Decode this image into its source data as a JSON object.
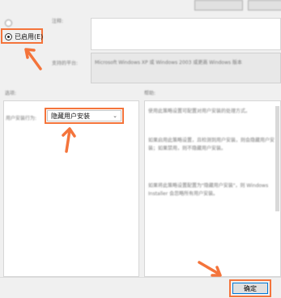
{
  "window": {
    "title": "",
    "top_button_label": ""
  },
  "radios": {
    "not_configured_label": "",
    "enabled_label": "已启用(E)",
    "disabled_label": ""
  },
  "labels": {
    "comment": "注释:",
    "supported_on": "支持的平台:",
    "options": "选项:",
    "help": "帮助:"
  },
  "supported_on_value": "Microsoft Windows XP 或 Windows 2003 或更高 Windows 版本",
  "options_panel": {
    "row_label": "用户安装行为:",
    "dropdown_value": "隐藏用户安装"
  },
  "help_text": [
    "使用此策略设置可配置对用户安装的处理方式。",
    "如果启用此策略设置，且检测到用户安装，则会隐藏用户安装；如果禁用，则不隐藏用户安装。",
    "如果将此策略设置配置为\"隐藏用户安装\"，则 Windows Installer 会忽略所有用户安装。"
  ],
  "buttons": {
    "ok_label": "确定"
  },
  "colors": {
    "highlight": "#f4743b",
    "arrow": "#f4743b"
  }
}
